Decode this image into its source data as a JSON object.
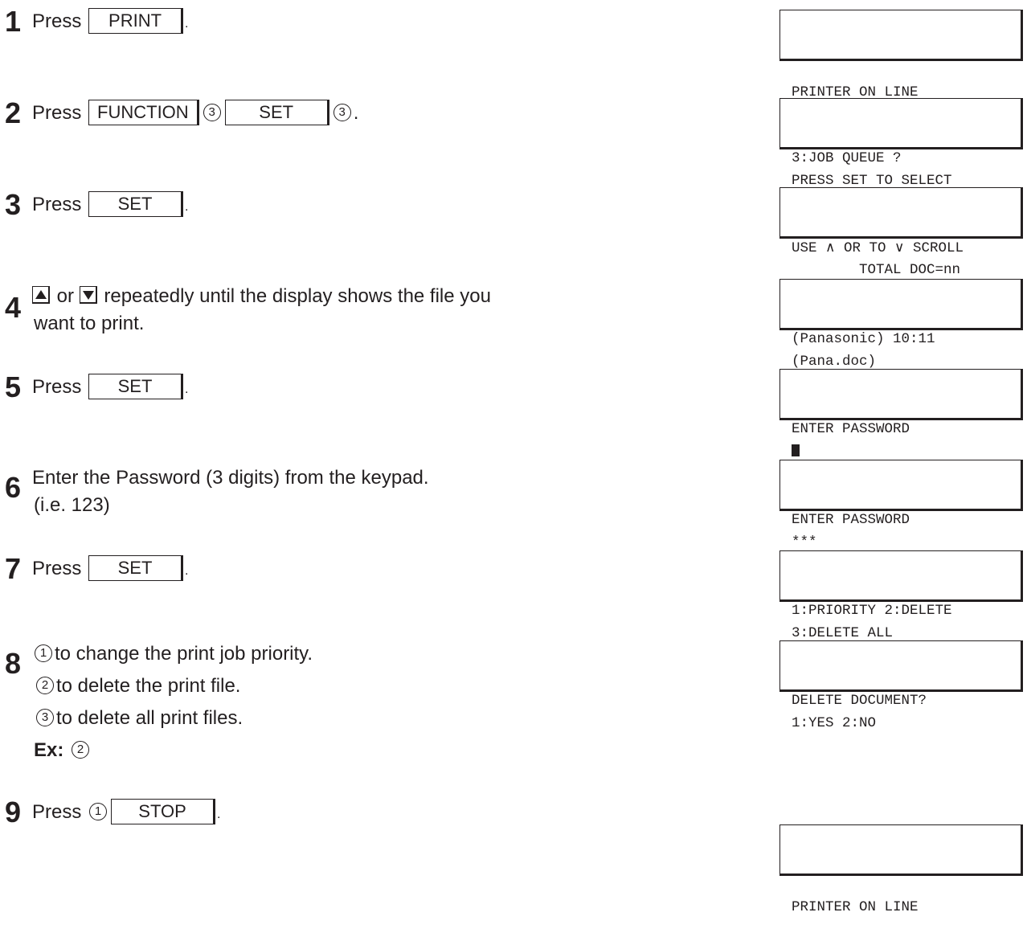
{
  "steps": [
    {
      "n": "1",
      "pre": "Press",
      "key": "PRINT",
      "post": "."
    },
    {
      "n": "2",
      "pre": "Press",
      "key1": "FUNCTION",
      "c1": "3",
      "key2": "SET",
      "c2": "3",
      "post": "."
    },
    {
      "n": "3",
      "pre": "Press",
      "key": "SET",
      "post": "."
    },
    {
      "n": "4",
      "mid": "or",
      "text": "repeatedly until the display shows the file you",
      "text2": "want to print."
    },
    {
      "n": "5",
      "pre": "Press",
      "key": "SET",
      "post": "."
    },
    {
      "n": "6",
      "text": "Enter the Password (3 digits) from the keypad.",
      "text2": "(i.e. 123)"
    },
    {
      "n": "7",
      "pre": "Press",
      "key": "SET",
      "post": "."
    },
    {
      "n": "8",
      "c1": "1",
      "t1": "to change the print job priority.",
      "c2": "2",
      "t2": "to delete the print file.",
      "c3": "3",
      "t3": "to delete all print files.",
      "ex_label": "Ex:",
      "ex_c": "2"
    },
    {
      "n": "9",
      "pre": "Press",
      "c": "1",
      "key": "STOP",
      "post": "."
    }
  ],
  "icons": {
    "up": "up-arrow-key-icon",
    "down": "down-arrow-key-icon"
  },
  "displays": [
    {
      "l1": "",
      "l2": "PRINTER ON LINE"
    },
    {
      "l1": "3:JOB QUEUE ?",
      "l2": "PRESS SET TO SELECT"
    },
    {
      "l1a": "USE ",
      "l1b": " OR TO ",
      "l1c": " SCROLL",
      "l2": "        TOTAL DOC=nn"
    },
    {
      "l1": "(Panasonic) 10:11",
      "l2": "(Pana.doc)"
    },
    {
      "l1": "ENTER PASSWORD",
      "l2": ""
    },
    {
      "l1": "ENTER PASSWORD",
      "l2": "***"
    },
    {
      "l1": "1:PRIORITY 2:DELETE",
      "l2": "3:DELETE ALL"
    },
    {
      "l1": "DELETE DOCUMENT?",
      "l2": "1:YES 2:NO"
    },
    {
      "l1": "",
      "l2": "PRINTER ON LINE"
    }
  ]
}
